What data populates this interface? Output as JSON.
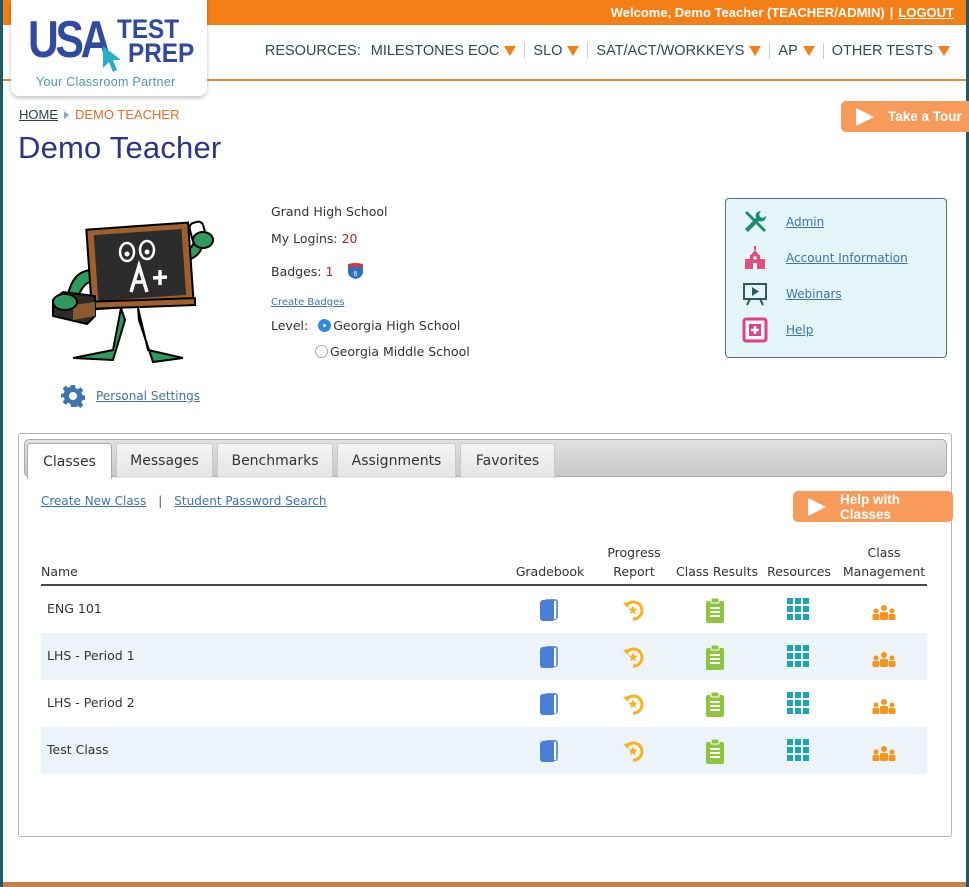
{
  "topbar": {
    "welcome": "Welcome, Demo Teacher (TEACHER/ADMIN)",
    "separator": "|",
    "logout": "LOGOUT"
  },
  "logo": {
    "usa": "USA",
    "test": "TEST",
    "prep": "PREP",
    "tagline": "Your Classroom Partner"
  },
  "nav": {
    "label": "RESOURCES:",
    "items": [
      {
        "label": "MILESTONES EOC"
      },
      {
        "label": "SLO"
      },
      {
        "label": "SAT/ACT/WORKKEYS"
      },
      {
        "label": "AP"
      },
      {
        "label": "OTHER TESTS"
      }
    ]
  },
  "breadcrumb": {
    "home": "HOME",
    "current": "DEMO TEACHER"
  },
  "page_title": "Demo Teacher",
  "take_tour": "Take a Tour",
  "profile": {
    "school": "Grand High School",
    "logins_label": "My Logins:",
    "logins_value": "20",
    "badges_label": "Badges:",
    "badges_value": "1",
    "create_badges": "Create Badges",
    "level_label": "Level:",
    "levels": [
      {
        "label": "Georgia High School",
        "selected": true
      },
      {
        "label": "Georgia Middle School",
        "selected": false
      }
    ],
    "personal_settings": "Personal Settings"
  },
  "quicklinks": [
    {
      "label": "Admin",
      "icon": "tools-icon"
    },
    {
      "label": "Account Information",
      "icon": "schoolhouse-icon"
    },
    {
      "label": "Webinars",
      "icon": "presentation-icon"
    },
    {
      "label": "Help",
      "icon": "help-plus-icon"
    }
  ],
  "tabs": [
    {
      "label": "Classes",
      "active": true
    },
    {
      "label": "Messages",
      "active": false
    },
    {
      "label": "Benchmarks",
      "active": false
    },
    {
      "label": "Assignments",
      "active": false
    },
    {
      "label": "Favorites",
      "active": false
    }
  ],
  "class_links": {
    "create": "Create New Class",
    "separator": "|",
    "password_search": "Student Password Search"
  },
  "help_classes": "Help with Classes",
  "table": {
    "headers": {
      "name": "Name",
      "gradebook": "Gradebook",
      "progress_1": "Progress",
      "progress_2": "Report",
      "results": "Class Results",
      "resources": "Resources",
      "mgmt_1": "Class",
      "mgmt_2": "Management"
    },
    "rows": [
      {
        "name": "ENG 101"
      },
      {
        "name": "LHS - Period 1"
      },
      {
        "name": "LHS - Period 2"
      },
      {
        "name": "Test Class"
      }
    ]
  },
  "colors": {
    "brand_orange": "#f57f17",
    "brand_navy": "#2c3585",
    "link_blue": "#3d74b0",
    "gradebook_blue": "#4a7fd6",
    "progress_yellow": "#f5b21a",
    "results_green": "#8cc63f",
    "resources_teal": "#1aa7b3",
    "management_orange": "#f7941d"
  }
}
